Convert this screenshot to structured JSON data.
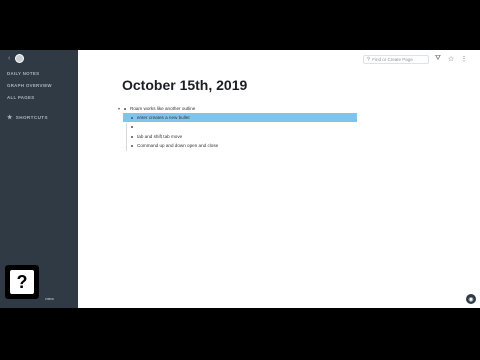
{
  "sidebar": {
    "items": [
      {
        "label": "DAILY NOTES"
      },
      {
        "label": "GRAPH OVERVIEW"
      },
      {
        "label": "ALL PAGES"
      }
    ],
    "shortcuts_label": "SHORTCUTS",
    "footer_text": "ᴄʜᴇᴄᴋ"
  },
  "topbar": {
    "search_placeholder": "Find or Create Page"
  },
  "page": {
    "title": "October 15th, 2019",
    "blocks": [
      {
        "text": "Roam works like another outline"
      },
      {
        "text": "enter creates a new bullet"
      },
      {
        "text": ""
      },
      {
        "text": "tab and shift tab move"
      },
      {
        "text": "Command up and down open and close"
      }
    ]
  },
  "help_box": {
    "glyph": "?"
  },
  "icons": {
    "search": "search-icon",
    "filter": "filter-icon",
    "star": "star-icon",
    "more": "more-icon"
  }
}
